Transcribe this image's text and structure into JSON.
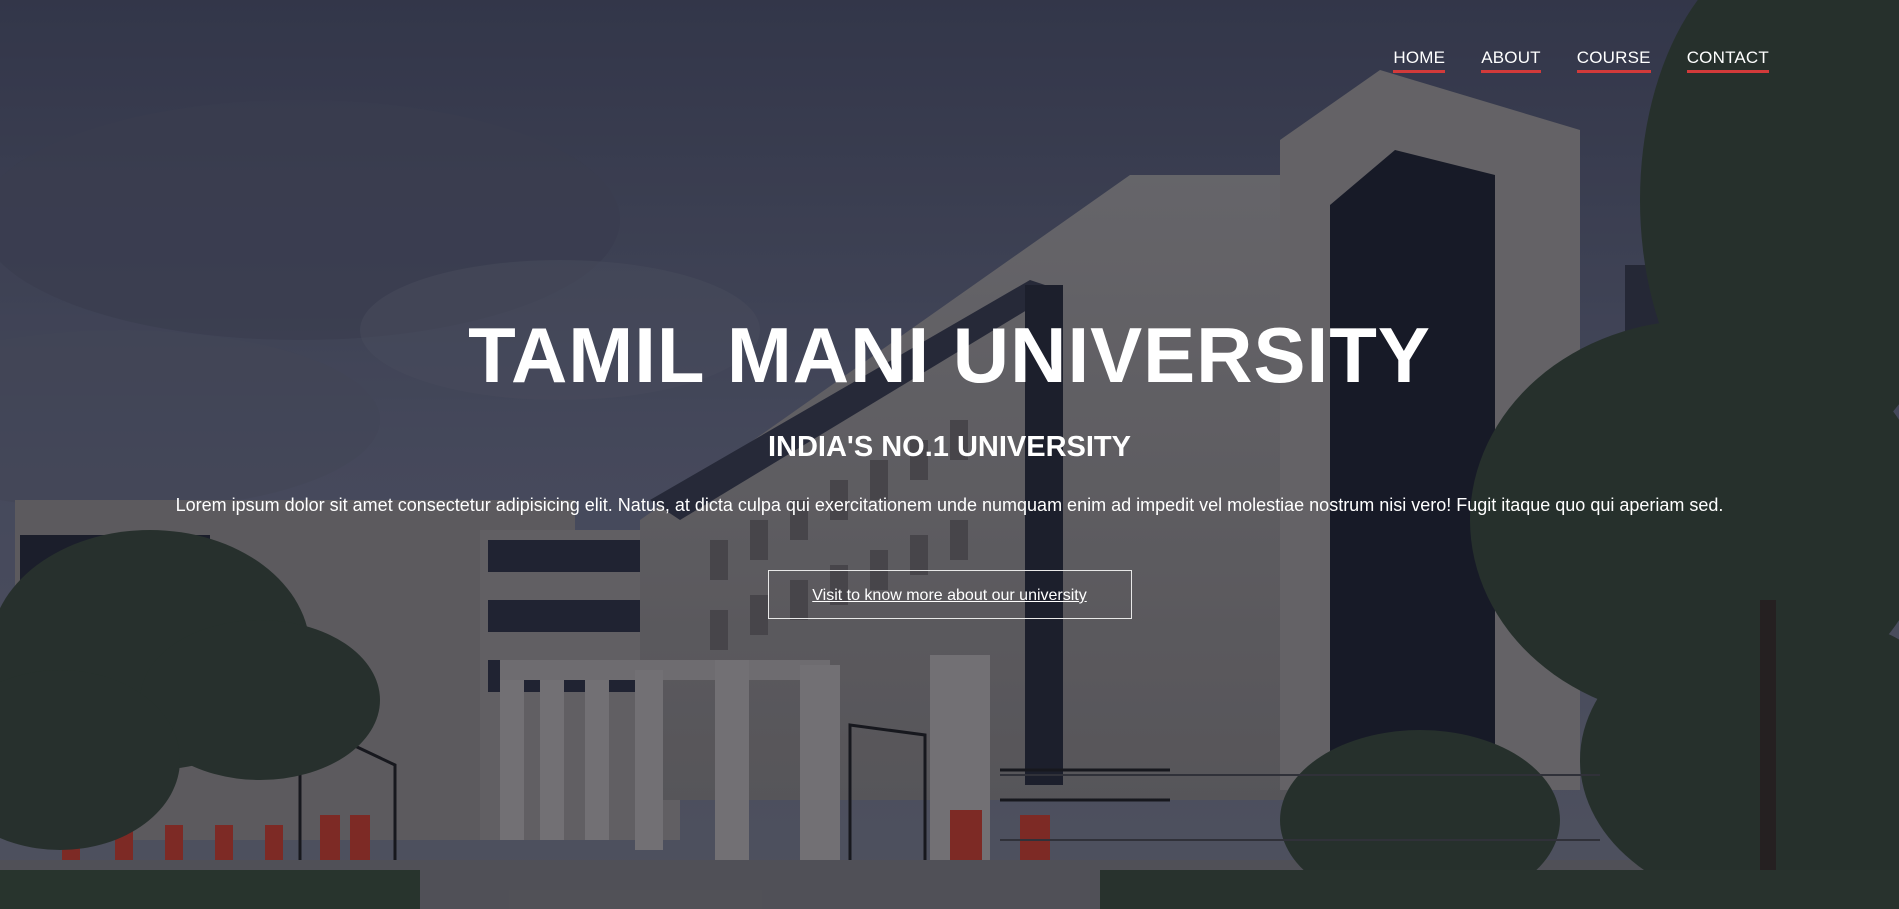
{
  "nav": {
    "items": [
      {
        "label": "HOME"
      },
      {
        "label": "ABOUT"
      },
      {
        "label": "COURSE"
      },
      {
        "label": "CONTACT"
      }
    ],
    "underline_color": "#d23a3a"
  },
  "hero": {
    "title": "TAMIL MANI UNIVERSITY",
    "subtitle": "INDIA'S NO.1 UNIVERSITY",
    "description": "Lorem ipsum dolor sit amet consectetur adipisicing elit. Natus, at dicta culpa qui exercitationem unde numquam enim ad impedit vel molestiae nostrum nisi vero! Fugit itaque quo qui aperiam sed.",
    "cta_label": "Visit to know more about our university"
  },
  "colors": {
    "overlay": "#1e2030",
    "text": "#ffffff"
  }
}
